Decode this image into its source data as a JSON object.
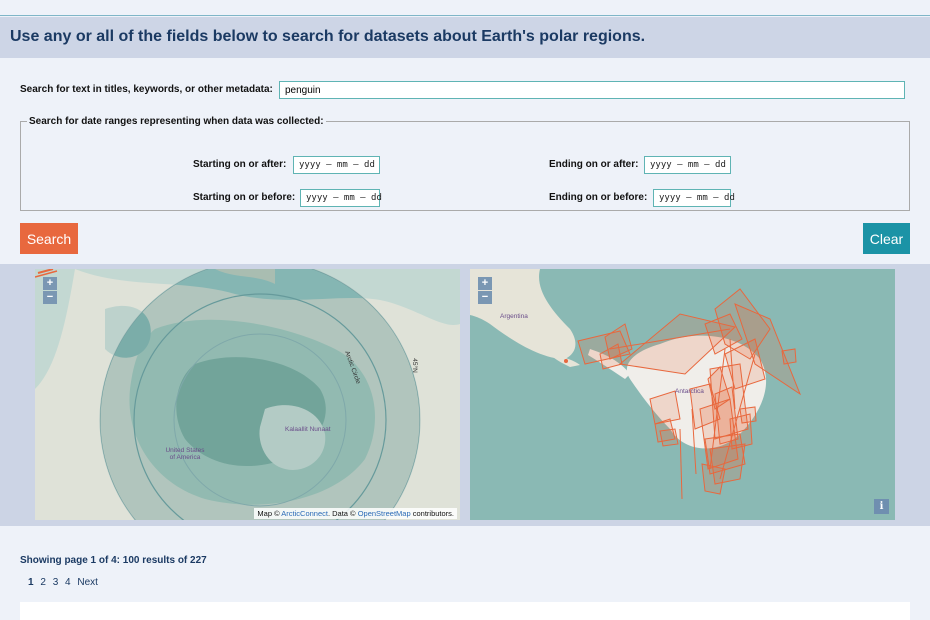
{
  "header": {
    "title": "Use any or all of the fields below to search for datasets about Earth's polar regions."
  },
  "text_search": {
    "label": "Search for text in titles, keywords, or other metadata:",
    "value": "penguin"
  },
  "dates": {
    "legend": "Search for date ranges representing when data was collected:",
    "start_after_label": "Starting on or after:",
    "start_before_label": "Starting on or before:",
    "end_after_label": "Ending on or after:",
    "end_before_label": "Ending on or before:",
    "placeholder": "yyyy – mm – dd"
  },
  "buttons": {
    "search": "Search",
    "clear": "Clear"
  },
  "maps": {
    "arctic": {
      "zoom_in": "+",
      "zoom_out": "−",
      "labels": {
        "arctic_circle": "Arctic Circle",
        "lat": "45°N",
        "greenland": "Kalaallit Nunaat",
        "usa": "United States of America"
      },
      "attribution": {
        "prefix": "Map © ",
        "arcticconnect": "ArcticConnect",
        "mid": ". Data © ",
        "osm": "OpenStreetMap",
        "suffix": " contributors."
      }
    },
    "antarctic": {
      "zoom_in": "+",
      "zoom_out": "−",
      "labels": {
        "argentina": "Argentina",
        "antarctica": "Antarctica"
      },
      "info": "i"
    }
  },
  "results": {
    "summary": "Showing page 1 of 4: 100 results of 227"
  },
  "pager": {
    "pages": [
      "1",
      "2",
      "3",
      "4"
    ],
    "next": "Next"
  },
  "colors": {
    "accent_orange": "#e8683e",
    "accent_teal": "#1b93a6",
    "header_text": "#1b3a63",
    "header_bg": "#cdd5e6"
  }
}
